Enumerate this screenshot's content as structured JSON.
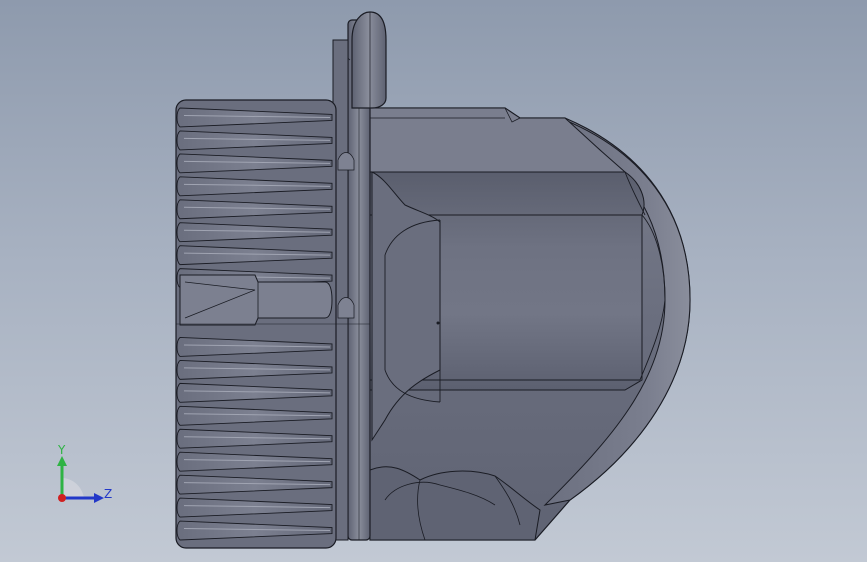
{
  "viewport": {
    "background_top": "#8e9aad",
    "background_bottom": "#c2c9d4"
  },
  "model": {
    "body_color": "#6c7080",
    "shade_color": "#575b6b",
    "highlight_color": "#9ea2b0",
    "edge_color": "#1a1c24",
    "fin_count": 19
  },
  "triad": {
    "y_label": "Y",
    "z_label": "Z",
    "y_color": "#2fb344",
    "z_color": "#2238c8",
    "x_color": "#d02020"
  }
}
